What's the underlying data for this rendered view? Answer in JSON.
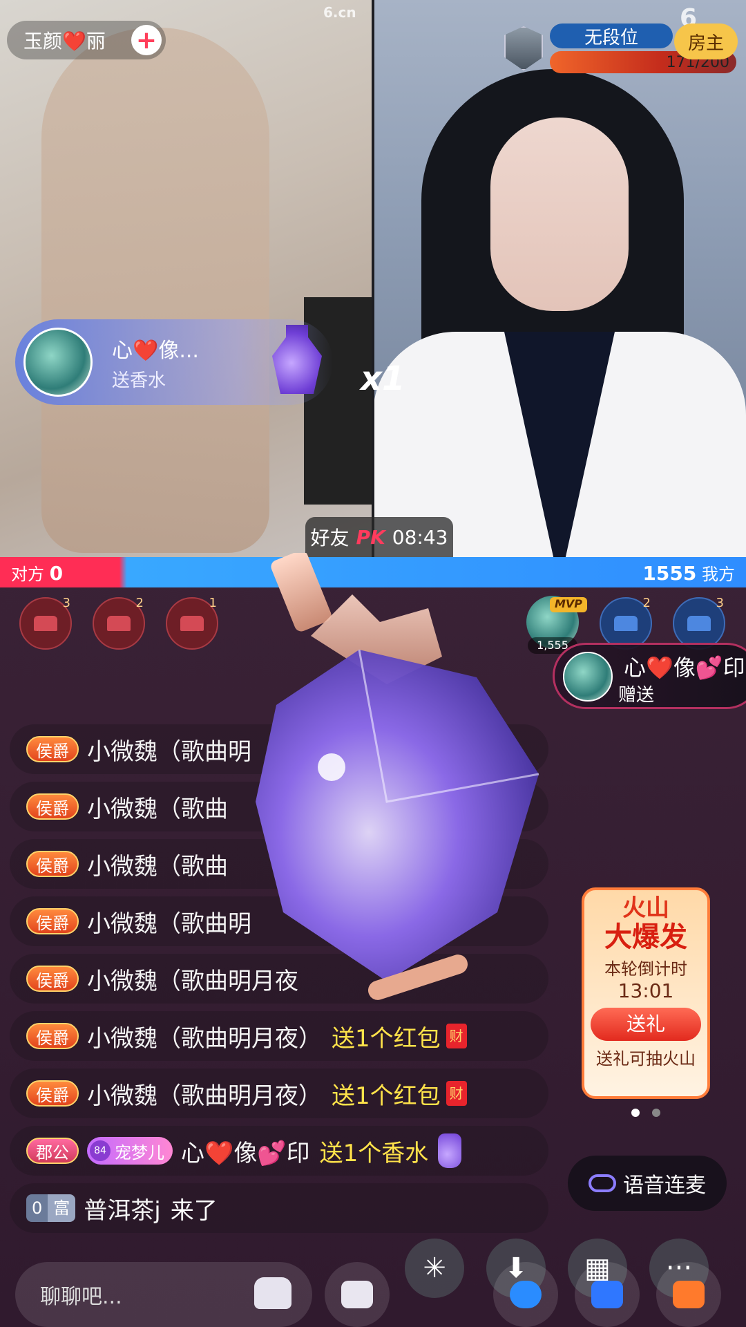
{
  "left_stream": {
    "host_name": "玉颜❤️丽",
    "follow_symbol": "+",
    "watermark": "6.cn"
  },
  "right_stream": {
    "rank_label": "无段位",
    "rank_progress": "171/200",
    "rank_progress_fraction": 0.855,
    "owner_label": "房主",
    "watermark": "6"
  },
  "gift_banner": {
    "sender": "心❤️像...",
    "action": "送香水",
    "multiplier": "x1"
  },
  "pk": {
    "mode_label": "好友",
    "pk_label": "PK",
    "timer": "08:43"
  },
  "score": {
    "opponent_label": "对方",
    "opponent_score": "0",
    "own_score": "1555",
    "own_label": "我方"
  },
  "seats": {
    "left": [
      {
        "rank": "3"
      },
      {
        "rank": "2"
      },
      {
        "rank": "1"
      }
    ],
    "mvp_tag": "MVP",
    "mvp_score": "1,555",
    "right": [
      {
        "rank": "2"
      },
      {
        "rank": "3"
      }
    ]
  },
  "gift_toast": {
    "sender": "心❤️像💕印",
    "action": "赠送"
  },
  "chat": [
    {
      "badge": "侯爵",
      "user": "小微魏（歌曲明",
      "msg": ""
    },
    {
      "badge": "侯爵",
      "user": "小微魏（歌曲",
      "msg": ""
    },
    {
      "badge": "侯爵",
      "user": "小微魏（歌曲",
      "msg": ""
    },
    {
      "badge": "侯爵",
      "user": "小微魏（歌曲明",
      "msg": ""
    },
    {
      "badge": "侯爵",
      "user": "小微魏（歌曲明月夜",
      "msg": ""
    },
    {
      "badge": "侯爵",
      "user": "小微魏（歌曲明月夜）",
      "msg": "送1个红包",
      "hongbao": "财"
    },
    {
      "badge": "侯爵",
      "user": "小微魏（歌曲明月夜）",
      "msg": "送1个红包",
      "hongbao": "财"
    }
  ],
  "chat_gift_row": {
    "badge": "郡公",
    "pet_level": "84",
    "pet_name": "宠梦儿",
    "user": "心❤️像💕印",
    "msg": "送1个香水"
  },
  "chat_enter_row": {
    "wealth_num": "0",
    "wealth_label": "富",
    "user": "普洱茶j",
    "msg": "来了"
  },
  "volcano": {
    "title_1": "火山",
    "title_2": "大爆发",
    "countdown_label": "本轮倒计时",
    "countdown": "13:01",
    "button": "送礼",
    "tip": "送礼可抽火山"
  },
  "voice_link": {
    "label": "语音连麦"
  },
  "chat_input": {
    "placeholder": "聊聊吧..."
  },
  "float_buttons": [
    {
      "icon": "sparkle-icon"
    },
    {
      "icon": "download-icon"
    },
    {
      "icon": "grid-icon"
    },
    {
      "icon": "more-icon",
      "label": "···"
    }
  ],
  "bottom_buttons": [
    {
      "icon": "message-icon"
    },
    {
      "icon": "game-icon"
    },
    {
      "icon": "vip-icon"
    },
    {
      "icon": "gift-icon"
    }
  ],
  "colors": {
    "opponent": "#ff2d55",
    "own": "#2f8dff",
    "highlight_text": "#ffe24a"
  }
}
